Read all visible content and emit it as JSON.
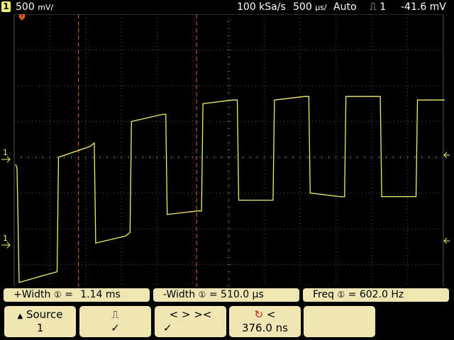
{
  "status_bar": {
    "channel_number": "1",
    "vertical_scale": "500",
    "vertical_unit": "mV/",
    "sample_rate": "100 kSa/s",
    "timebase": "500",
    "timebase_unit": "µs/",
    "trigger_mode": "Auto",
    "trigger_source": "1",
    "trigger_level": "-41.6 mV"
  },
  "markers": {
    "ch1_ground": "1",
    "ch1_ref": "1",
    "trigger_position": "T"
  },
  "measurements": [
    {
      "label": "+Width",
      "source": "①",
      "eq": "=",
      "value": "1.14 ms"
    },
    {
      "label": "-Width",
      "source": "①",
      "eq": "=",
      "value": "510.0 µs"
    },
    {
      "label": "Freq",
      "source": "①",
      "eq": "=",
      "value": "602.0  Hz"
    }
  ],
  "softkeys": {
    "source": {
      "label": "Source",
      "value": "1"
    },
    "pulse_select": {
      "label": "⎍",
      "check": "✓"
    },
    "cursor_controls": {
      "label": "<  >  ><",
      "check": "✓"
    },
    "cursor_value": {
      "label": "<",
      "value": "376.0 ns"
    }
  },
  "colors": {
    "trace": "#f2ef6a",
    "cursor": "#e0602a",
    "grid": "#555555",
    "softkey_bg": "#efe6b3"
  },
  "waveform": {
    "volts_per_div": 0.5,
    "seconds_per_div": 0.0005,
    "samples_v": [
      [
        0,
        -0.1
      ],
      [
        0.02,
        -0.15
      ],
      [
        0.05,
        -1.75
      ],
      [
        0.4,
        -1.65
      ],
      [
        0.58,
        -1.6
      ],
      [
        0.6,
        0.0
      ],
      [
        1.04,
        0.15
      ],
      [
        1.1,
        0.2
      ],
      [
        1.12,
        -1.2
      ],
      [
        1.54,
        -1.1
      ],
      [
        1.6,
        -1.05
      ],
      [
        1.62,
        0.5
      ],
      [
        2.06,
        0.6
      ],
      [
        2.1,
        0.6
      ],
      [
        2.12,
        -0.8
      ],
      [
        2.54,
        -0.75
      ],
      [
        2.6,
        -0.75
      ],
      [
        2.62,
        0.75
      ],
      [
        3.04,
        0.8
      ],
      [
        3.1,
        0.8
      ],
      [
        3.12,
        -0.6
      ],
      [
        3.54,
        -0.6
      ],
      [
        3.6,
        -0.6
      ],
      [
        3.62,
        0.8
      ],
      [
        4.04,
        0.85
      ],
      [
        4.1,
        0.85
      ],
      [
        4.12,
        -0.5
      ],
      [
        4.54,
        -0.55
      ],
      [
        4.6,
        -0.55
      ],
      [
        4.62,
        0.85
      ],
      [
        5.04,
        0.85
      ],
      [
        5.1,
        0.85
      ],
      [
        5.12,
        -0.55
      ],
      [
        5.54,
        -0.55
      ],
      [
        5.6,
        -0.55
      ],
      [
        5.62,
        0.8
      ],
      [
        6.0,
        0.8
      ]
    ],
    "cursor_a_div": 0.9,
    "cursor_b_div": 2.55
  }
}
